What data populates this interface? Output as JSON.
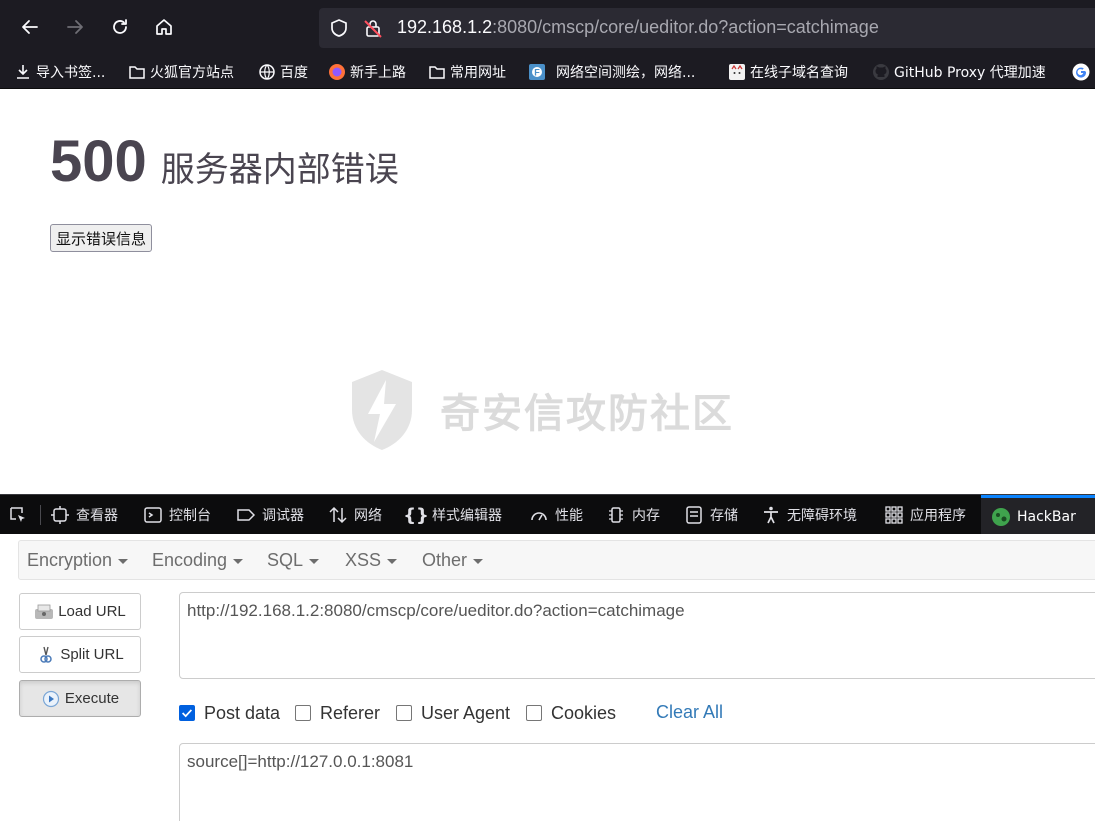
{
  "browser": {
    "url_host": "192.168.1.2",
    "url_rest": ":8080/cmscp/core/ueditor.do?action=catchimage",
    "bookmarks": [
      {
        "label": "导入书签...",
        "icon": "import-icon"
      },
      {
        "label": "火狐官方站点",
        "icon": "folder-icon"
      },
      {
        "label": "百度",
        "icon": "globe-icon"
      },
      {
        "label": "新手上路",
        "icon": "firefox-icon"
      },
      {
        "label": "常用网址",
        "icon": "folder-icon"
      },
      {
        "label": "网络空间测绘，网络...",
        "icon": "fofa-icon"
      },
      {
        "label": "在线子域名查询",
        "icon": "cat-icon"
      },
      {
        "label": "GitHub Proxy 代理加速",
        "icon": "github-icon"
      }
    ]
  },
  "page": {
    "error_code": "500",
    "error_message": "服务器内部错误",
    "show_error_button": "显示错误信息",
    "watermark": "奇安信攻防社区"
  },
  "devtools": {
    "tabs": [
      {
        "label": "查看器",
        "icon": "inspector-icon"
      },
      {
        "label": "控制台",
        "icon": "console-icon"
      },
      {
        "label": "调试器",
        "icon": "debugger-icon"
      },
      {
        "label": "网络",
        "icon": "network-icon"
      },
      {
        "label": "样式编辑器",
        "icon": "style-editor-icon"
      },
      {
        "label": "性能",
        "icon": "performance-icon"
      },
      {
        "label": "内存",
        "icon": "memory-icon"
      },
      {
        "label": "存储",
        "icon": "storage-icon"
      },
      {
        "label": "无障碍环境",
        "icon": "accessibility-icon"
      },
      {
        "label": "应用程序",
        "icon": "application-icon"
      },
      {
        "label": "HackBar",
        "icon": "hackbar-icon",
        "active": true
      }
    ]
  },
  "hackbar": {
    "menu": [
      "Encryption",
      "Encoding",
      "SQL",
      "XSS",
      "Other"
    ],
    "buttons": {
      "load_url": "Load URL",
      "split_url": "Split URL",
      "execute": "Execute"
    },
    "url_value": "http://192.168.1.2:8080/cmscp/core/ueditor.do?action=catchimage",
    "options": [
      {
        "label": "Post data",
        "checked": true
      },
      {
        "label": "Referer",
        "checked": false
      },
      {
        "label": "User Agent",
        "checked": false
      },
      {
        "label": "Cookies",
        "checked": false
      }
    ],
    "clear_all": "Clear All",
    "post_value": "source[]=http://127.0.0.1:8081"
  },
  "colors": {
    "chrome_bg": "#1c1b22",
    "urlbar_bg": "#2b2a33",
    "active_tab_accent": "#0a84ff",
    "checkbox_on": "#0060df",
    "link": "#337ab7"
  }
}
